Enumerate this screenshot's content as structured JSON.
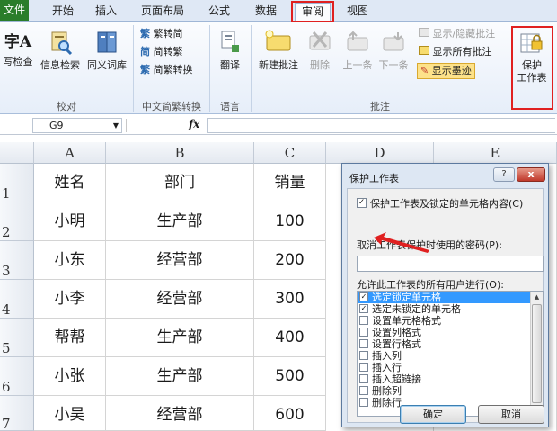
{
  "tabs": [
    {
      "label": "文件"
    },
    {
      "label": "开始"
    },
    {
      "label": "插入"
    },
    {
      "label": "页面布局"
    },
    {
      "label": "公式"
    },
    {
      "label": "数据"
    },
    {
      "label": "审阅"
    },
    {
      "label": "视图"
    }
  ],
  "ribbon": {
    "proofing": {
      "spell_prefix": "字A",
      "spell": "写检查",
      "research": "信息检索",
      "thesaurus": "同义词库",
      "label": "校对"
    },
    "chinese": {
      "to_trad": "繁转简",
      "to_simp": "简转繁",
      "convert": "简繁转换",
      "label": "中文简繁转换"
    },
    "language": {
      "translate": "翻译",
      "label": "语言"
    },
    "comments": {
      "new": "新建批注",
      "delete": "删除",
      "prev": "上一条",
      "next": "下一条",
      "show_hide": "显示/隐藏批注",
      "show_all": "显示所有批注",
      "show_ink": "显示墨迹",
      "label": "批注"
    },
    "protect": {
      "line1": "保护",
      "line2": "工作表"
    }
  },
  "formula_bar": {
    "name_box": "G9",
    "fx": "fx",
    "value": ""
  },
  "sheet": {
    "columns": [
      "A",
      "B",
      "C",
      "D",
      "E"
    ],
    "rows": [
      "1",
      "2",
      "3",
      "4",
      "5",
      "6",
      "7"
    ],
    "data": [
      [
        "姓名",
        "部门",
        "销量"
      ],
      [
        "小明",
        "生产部",
        "100"
      ],
      [
        "小东",
        "经营部",
        "200"
      ],
      [
        "小李",
        "经营部",
        "300"
      ],
      [
        "帮帮",
        "生产部",
        "400"
      ],
      [
        "小张",
        "生产部",
        "500"
      ],
      [
        "小吴",
        "经营部",
        "600"
      ]
    ]
  },
  "dialog": {
    "title": "保护工作表",
    "help": "?",
    "close": "x",
    "protect_contents": "保护工作表及锁定的单元格内容(C)",
    "password_label": "取消工作表保护时使用的密码(P):",
    "password_value": "",
    "allow_label": "允许此工作表的所有用户进行(O):",
    "permissions": [
      {
        "label": "选定锁定单元格",
        "checked": true
      },
      {
        "label": "选定未锁定的单元格",
        "checked": true
      },
      {
        "label": "设置单元格格式",
        "checked": false
      },
      {
        "label": "设置列格式",
        "checked": false
      },
      {
        "label": "设置行格式",
        "checked": false
      },
      {
        "label": "插入列",
        "checked": false
      },
      {
        "label": "插入行",
        "checked": false
      },
      {
        "label": "插入超链接",
        "checked": false
      },
      {
        "label": "删除列",
        "checked": false
      },
      {
        "label": "删除行",
        "checked": false
      }
    ],
    "ok": "确定",
    "cancel": "取消"
  },
  "colors": {
    "highlight": "#e02020",
    "file_tab": "#2a7d2a",
    "selection": "#3399ff"
  }
}
